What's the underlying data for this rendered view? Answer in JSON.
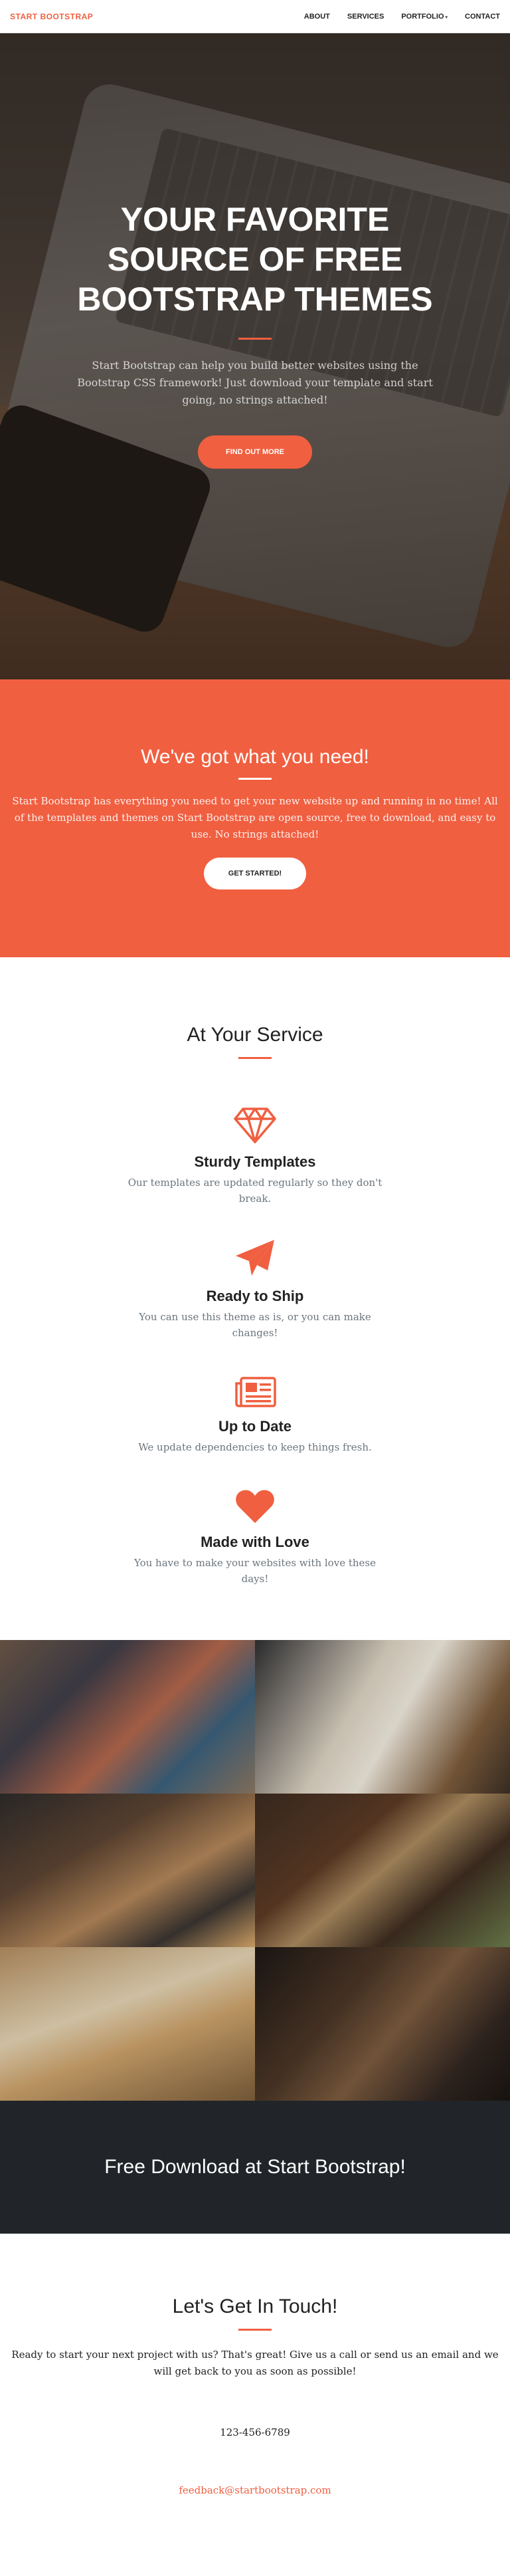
{
  "navbar": {
    "brand": "START BOOTSTRAP",
    "items": [
      {
        "label": "ABOUT",
        "has_caret": false
      },
      {
        "label": "SERVICES",
        "has_caret": false
      },
      {
        "label": "PORTFOLIO",
        "has_caret": true
      },
      {
        "label": "CONTACT",
        "has_caret": false
      }
    ]
  },
  "hero": {
    "title": "YOUR FAVORITE SOURCE OF FREE BOOTSTRAP THEMES",
    "text": "Start Bootstrap can help you build better websites using the Bootstrap CSS framework! Just download your template and start going, no strings attached!",
    "button": "FIND OUT MORE"
  },
  "about": {
    "title": "We've got what you need!",
    "text": "Start Bootstrap has everything you need to get your new website up and running in no time! All of the templates and themes on Start Bootstrap are open source, free to download, and easy to use. No strings attached!",
    "button": "GET STARTED!"
  },
  "services": {
    "title": "At Your Service",
    "items": [
      {
        "icon": "diamond-icon",
        "title": "Sturdy Templates",
        "text": "Our templates are updated regularly so they don't break."
      },
      {
        "icon": "paper-plane-icon",
        "title": "Ready to Ship",
        "text": "You can use this theme as is, or you can make changes!"
      },
      {
        "icon": "newspaper-icon",
        "title": "Up to Date",
        "text": "We update dependencies to keep things fresh."
      },
      {
        "icon": "heart-icon",
        "title": "Made with Love",
        "text": "You have to make your websites with love these days!"
      }
    ]
  },
  "portfolio": {
    "tiles": [
      "portfolio-image-1",
      "portfolio-image-2",
      "portfolio-image-3",
      "portfolio-image-4",
      "portfolio-image-5",
      "portfolio-image-6"
    ]
  },
  "download": {
    "title": "Free Download at Start Bootstrap!"
  },
  "contact": {
    "title": "Let's Get In Touch!",
    "text": "Ready to start your next project with us? That's great! Give us a call or send us an email and we will get back to you as soon as possible!",
    "phone": "123-456-6789",
    "email": "feedback@startbootstrap.com"
  },
  "colors": {
    "primary": "#f05f40",
    "dark": "#212529",
    "muted": "#6c757d"
  }
}
